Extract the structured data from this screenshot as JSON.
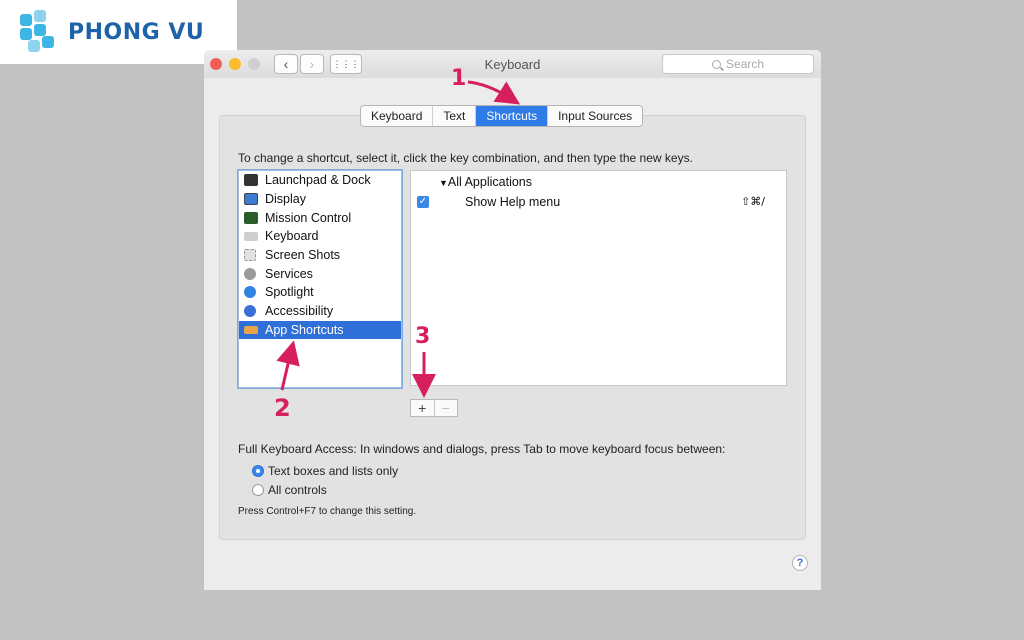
{
  "brand": {
    "name": "PHONG VU",
    "color": "#1e63a9",
    "mark_color": "#3fb5e6"
  },
  "window": {
    "title": "Keyboard",
    "search_placeholder": "Search",
    "nav": {
      "back": "‹",
      "forward": "›",
      "grid": "⋮⋮⋮"
    },
    "traffic": [
      "#f25f57",
      "#f9bd2e",
      "#cfcfcf"
    ]
  },
  "tabs": [
    {
      "label": "Keyboard",
      "active": false
    },
    {
      "label": "Text",
      "active": false
    },
    {
      "label": "Shortcuts",
      "active": true
    },
    {
      "label": "Input Sources",
      "active": false
    }
  ],
  "instruction": "To change a shortcut, select it, click the key combination, and then type the new keys.",
  "categories": [
    {
      "label": "Launchpad & Dock",
      "icon": "launchpad-icon",
      "color": "#333333"
    },
    {
      "label": "Display",
      "icon": "display-icon",
      "color": "#3a7bd5"
    },
    {
      "label": "Mission Control",
      "icon": "mission-control-icon",
      "color": "#2b5d2b"
    },
    {
      "label": "Keyboard",
      "icon": "keyboard-icon",
      "color": "#bbbbbb"
    },
    {
      "label": "Screen Shots",
      "icon": "screenshot-icon",
      "color": "#d9d9d9"
    },
    {
      "label": "Services",
      "icon": "gear-icon",
      "color": "#9a9a9a"
    },
    {
      "label": "Spotlight",
      "icon": "spotlight-icon",
      "color": "#2f84e0"
    },
    {
      "label": "Accessibility",
      "icon": "accessibility-icon",
      "color": "#3b6fd8"
    },
    {
      "label": "App Shortcuts",
      "icon": "app-shortcuts-icon",
      "color": "#e7a44a",
      "selected": true
    }
  ],
  "shortcuts": {
    "group": "All Applications",
    "items": [
      {
        "enabled": true,
        "name": "Show Help menu",
        "keys": "⇧⌘/"
      }
    ]
  },
  "buttons": {
    "add": "+",
    "remove": "−",
    "help": "?"
  },
  "keyboard_access": {
    "label": "Full Keyboard Access: In windows and dialogs, press Tab to move keyboard focus between:",
    "options": [
      {
        "label": "Text boxes and lists only",
        "selected": true
      },
      {
        "label": "All controls",
        "selected": false
      }
    ],
    "note": "Press Control+F7 to change this setting."
  },
  "annotations": [
    {
      "label": "1"
    },
    {
      "label": "2"
    },
    {
      "label": "3"
    }
  ],
  "accent_color": "#2f7ce8",
  "annotation_color": "#d6205e"
}
